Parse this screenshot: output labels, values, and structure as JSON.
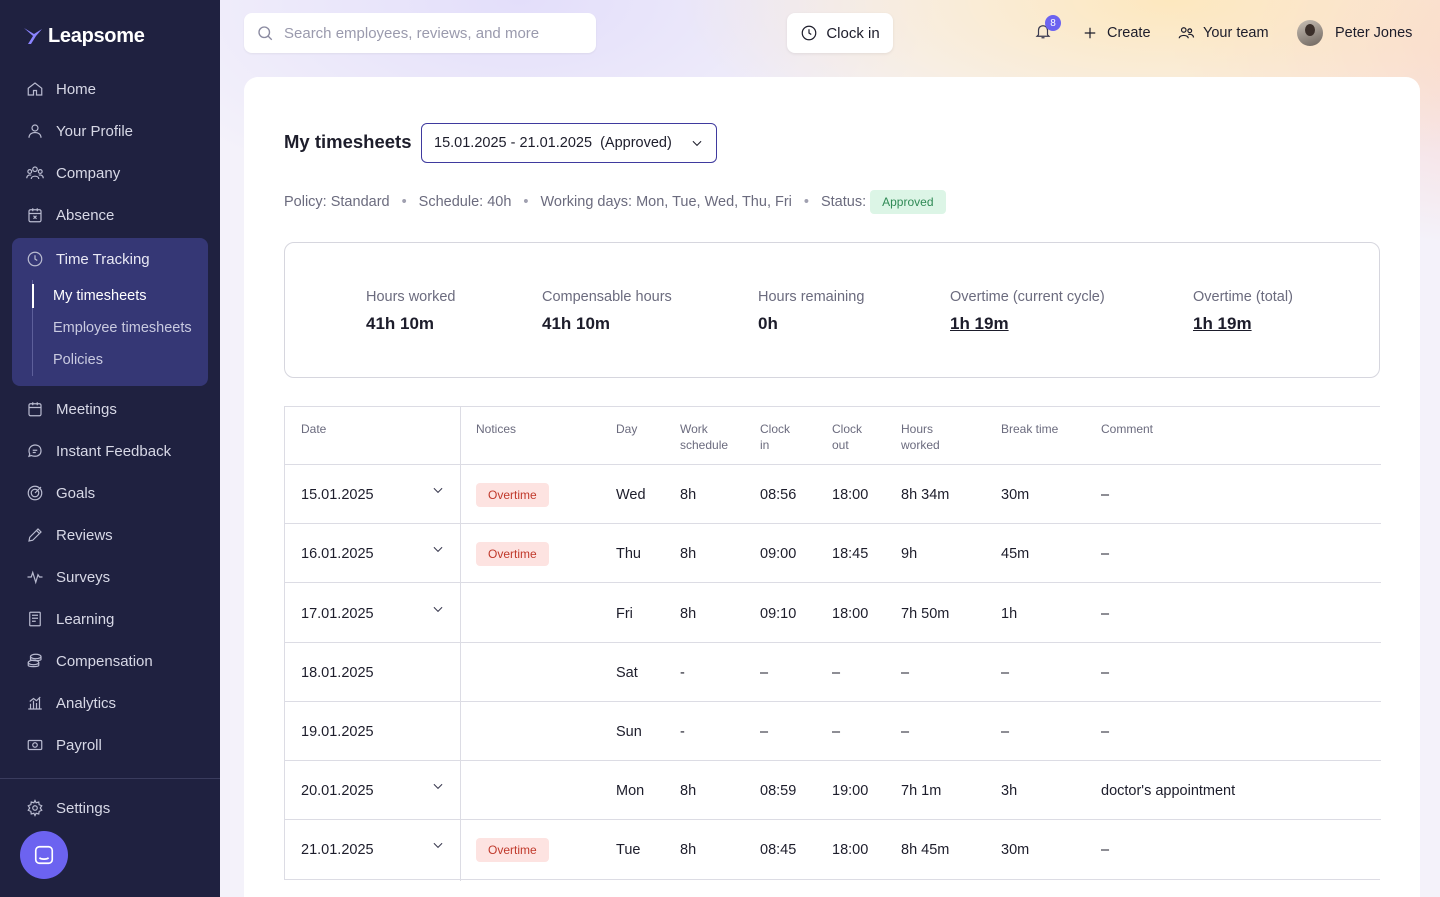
{
  "app": {
    "name": "Leapsome"
  },
  "sidebar": {
    "items": [
      {
        "label": "Home",
        "icon": "home-icon"
      },
      {
        "label": "Your Profile",
        "icon": "user-icon"
      },
      {
        "label": "Company",
        "icon": "people-icon"
      },
      {
        "label": "Absence",
        "icon": "calendar-x-icon"
      }
    ],
    "time_tracking": {
      "label": "Time Tracking",
      "icon": "clock-icon",
      "sub_items": [
        {
          "label": "My timesheets",
          "active": true
        },
        {
          "label": "Employee timesheets"
        },
        {
          "label": "Policies"
        }
      ]
    },
    "items_after": [
      {
        "label": "Meetings",
        "icon": "calendar-icon"
      },
      {
        "label": "Instant Feedback",
        "icon": "chat-icon"
      },
      {
        "label": "Goals",
        "icon": "target-icon"
      },
      {
        "label": "Reviews",
        "icon": "pencil-icon"
      },
      {
        "label": "Surveys",
        "icon": "pulse-icon"
      },
      {
        "label": "Learning",
        "icon": "book-icon"
      },
      {
        "label": "Compensation",
        "icon": "coins-icon"
      },
      {
        "label": "Analytics",
        "icon": "chart-icon"
      },
      {
        "label": "Payroll",
        "icon": "money-icon"
      }
    ],
    "settings": {
      "label": "Settings",
      "icon": "gear-icon"
    }
  },
  "topbar": {
    "search_placeholder": "Search employees, reviews, and more",
    "clock_in_label": "Clock in",
    "notifications_count": "8",
    "create_label": "Create",
    "your_team_label": "Your team",
    "user_name": "Peter Jones"
  },
  "page": {
    "title": "My timesheets",
    "period": "15.01.2025 - 21.01.2025  (Approved)",
    "meta": {
      "policy": "Policy: Standard",
      "schedule": "Schedule: 40h",
      "working_days": "Working days: Mon, Tue, Wed, Thu, Fri",
      "status_label": "Status:",
      "status_value": "Approved"
    },
    "stats": [
      {
        "label": "Hours worked",
        "value": "41h 10m"
      },
      {
        "label": "Compensable hours",
        "value": "41h 10m"
      },
      {
        "label": "Hours remaining",
        "value": "0h"
      },
      {
        "label": "Overtime (current cycle)",
        "value": "1h 19m"
      },
      {
        "label": "Overtime (total)",
        "value": "1h 19m"
      }
    ]
  },
  "table": {
    "headers": {
      "date": "Date",
      "notices": "Notices",
      "day": "Day",
      "work_schedule_1": "Work",
      "work_schedule_2": "schedule",
      "clock_in_1": "Clock",
      "clock_in_2": "in",
      "clock_out_1": "Clock",
      "clock_out_2": "out",
      "hours_worked_1": "Hours",
      "hours_worked_2": "worked",
      "break_time": "Break time",
      "comment": "Comment"
    },
    "rows": [
      {
        "date": "15.01.2025",
        "notice": "Overtime",
        "day": "Wed",
        "schedule": "8h",
        "clock_in": "08:56",
        "clock_out": "18:00",
        "hours": "8h 34m",
        "break": "30m",
        "comment": "–"
      },
      {
        "date": "16.01.2025",
        "notice": "Overtime",
        "day": "Thu",
        "schedule": "8h",
        "clock_in": "09:00",
        "clock_out": "18:45",
        "hours": "9h",
        "break": "45m",
        "comment": "–"
      },
      {
        "date": "17.01.2025",
        "notice": "",
        "day": "Fri",
        "schedule": "8h",
        "clock_in": "09:10",
        "clock_out": "18:00",
        "hours": "7h 50m",
        "break": "1h",
        "comment": "–"
      },
      {
        "date": "18.01.2025",
        "notice": "",
        "day": "Sat",
        "schedule": "-",
        "clock_in": "–",
        "clock_out": "–",
        "hours": "–",
        "break": "–",
        "comment": "–"
      },
      {
        "date": "19.01.2025",
        "notice": "",
        "day": "Sun",
        "schedule": "-",
        "clock_in": "–",
        "clock_out": "–",
        "hours": "–",
        "break": "–",
        "comment": "–"
      },
      {
        "date": "20.01.2025",
        "notice": "",
        "day": "Mon",
        "schedule": "8h",
        "clock_in": "08:59",
        "clock_out": "19:00",
        "hours": "7h 1m",
        "break": "3h",
        "comment": "doctor's appointment"
      },
      {
        "date": "21.01.2025",
        "notice": "Overtime",
        "day": "Tue",
        "schedule": "8h",
        "clock_in": "08:45",
        "clock_out": "18:00",
        "hours": "8h 45m",
        "break": "30m",
        "comment": "–"
      }
    ]
  },
  "colors": {
    "sidebar_bg": "#1f2140",
    "sidebar_active_group": "#353775",
    "accent": "#6c63f0",
    "approved_bg": "#dcf5e6",
    "approved_text": "#2f8a55",
    "overtime_bg": "#fde3e1",
    "overtime_text": "#c0392b"
  }
}
